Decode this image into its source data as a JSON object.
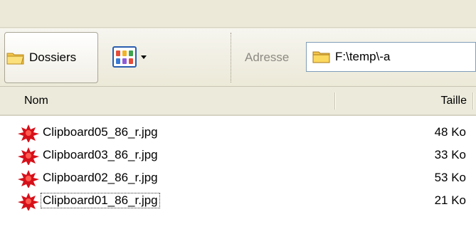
{
  "colors": {
    "toolbar_bg": "#ece9d8",
    "header_bg": "#ebeadb",
    "address_border": "#7f9db9",
    "views_icon_border": "#2a5db0",
    "file_icon_red": "#d6101a",
    "folder_yellow": "#f3c54b"
  },
  "toolbar": {
    "folders_label": "Dossiers",
    "folders_icon": "folder-icon",
    "views_icon": "views-icon",
    "address_label": "Adresse",
    "address_value": "F:\\temp\\-a"
  },
  "columns": {
    "name": "Nom",
    "size": "Taille"
  },
  "files": [
    {
      "name": "Clipboard05_86_r.jpg",
      "size": "48 Ko",
      "icon": "image-file-icon"
    },
    {
      "name": "Clipboard03_86_r.jpg",
      "size": "33 Ko",
      "icon": "image-file-icon"
    },
    {
      "name": "Clipboard02_86_r.jpg",
      "size": "53 Ko",
      "icon": "image-file-icon"
    },
    {
      "name": "Clipboard01_86_r.jpg",
      "size": "21 Ko",
      "icon": "image-file-icon",
      "focused": true
    }
  ]
}
